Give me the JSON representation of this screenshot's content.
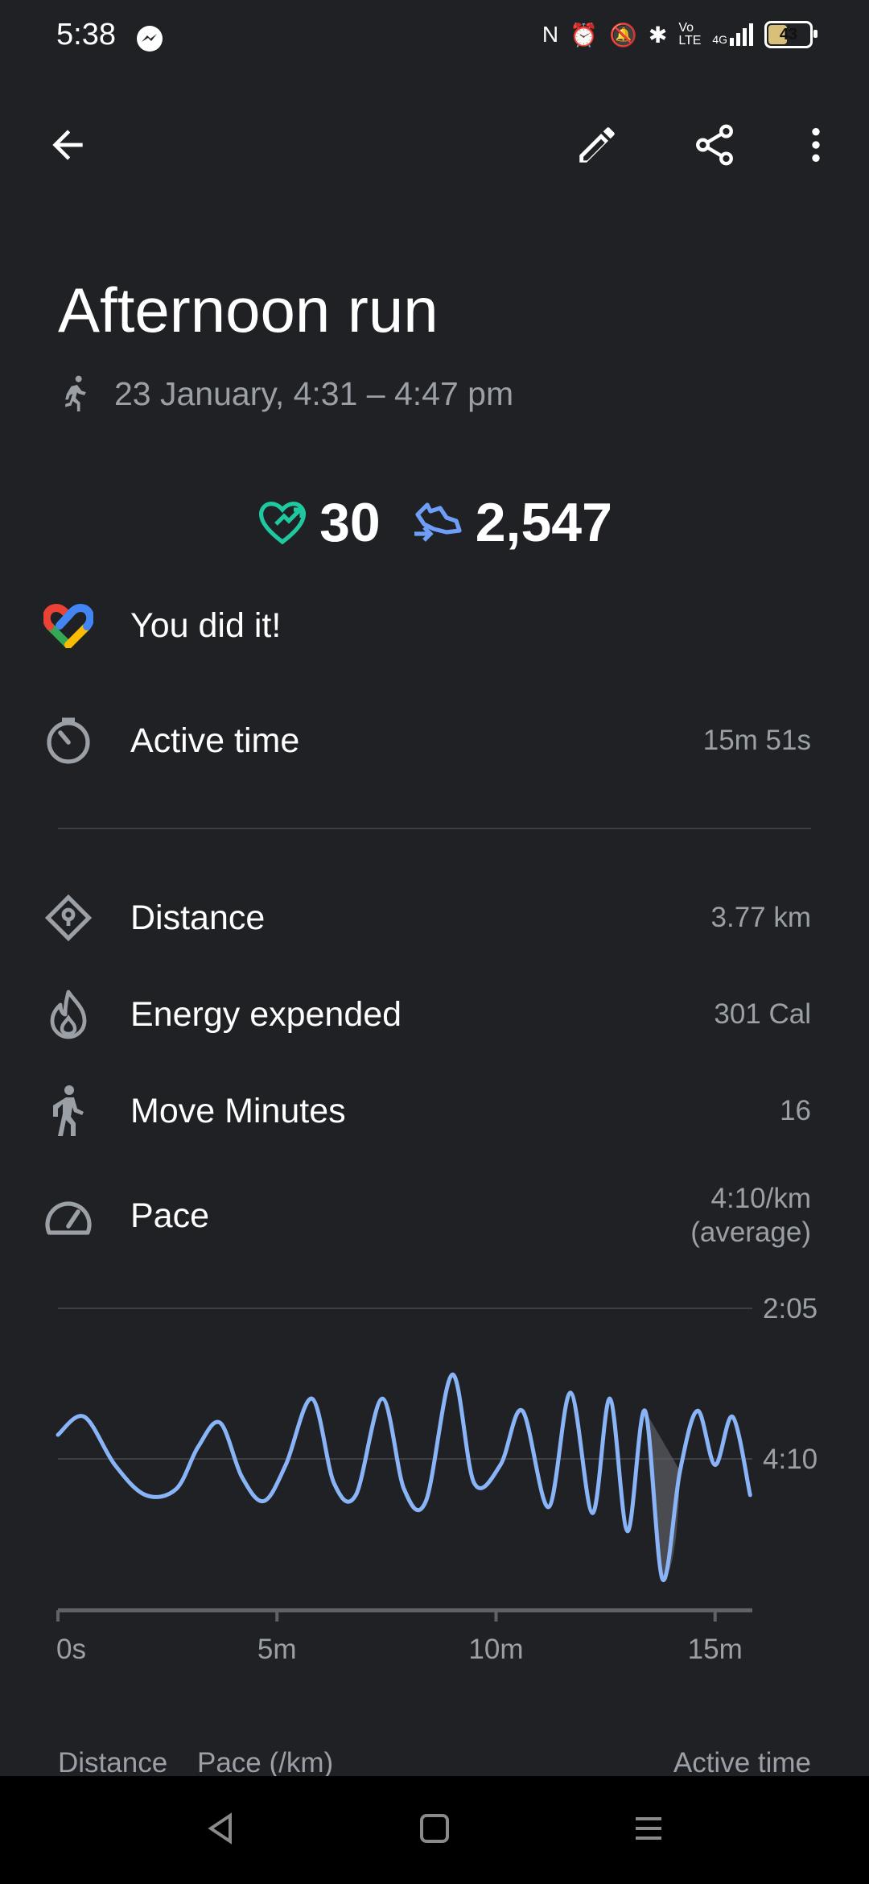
{
  "status_bar": {
    "time": "5:38",
    "network": "4G",
    "volte": "Vo LTE",
    "battery": "43"
  },
  "header": {
    "back_icon": "arrow-back-icon",
    "edit_icon": "pencil-icon",
    "share_icon": "share-icon",
    "more_icon": "more-vert-icon"
  },
  "activity": {
    "title": "Afternoon run",
    "datetime": "23 January, 4:31 – 4:47 pm",
    "heart_points": "30",
    "steps": "2,547"
  },
  "goal": {
    "label": "You did it!"
  },
  "metrics": [
    {
      "icon": "timer-icon",
      "label": "Active time",
      "value": "15m 51s"
    },
    {
      "icon": "location-icon",
      "label": "Distance",
      "value": "3.77 km"
    },
    {
      "icon": "flame-icon",
      "label": "Energy expended",
      "value": "301 Cal"
    },
    {
      "icon": "walker-icon",
      "label": "Move Minutes",
      "value": "16"
    },
    {
      "icon": "speedometer-icon",
      "label": "Pace",
      "value": "4:10/km",
      "value_sub": "(average)"
    }
  ],
  "colors": {
    "background": "#202124",
    "heart_green": "#1ec9a0",
    "steps_blue": "#6e9ef7",
    "line_blue": "#8ab4f8"
  },
  "chart_data": {
    "type": "line",
    "title": "",
    "xlabel": "",
    "ylabel": "Pace",
    "x_ticks": [
      "0s",
      "5m",
      "10m",
      "15m"
    ],
    "y_ticks": [
      "2:05",
      "4:10"
    ],
    "ylim": [
      "2:05",
      "6:15"
    ],
    "xlim": [
      0,
      15.85
    ],
    "series": [
      {
        "x": [
          0,
          0.6,
          1.3,
          2.0,
          2.7,
          3.2,
          3.7,
          4.2,
          4.7,
          5.2,
          5.8,
          6.3,
          6.8,
          7.4,
          7.9,
          8.4,
          9.0,
          9.5,
          10.1,
          10.6,
          11.2,
          11.7,
          12.2,
          12.6,
          13.0,
          13.4,
          13.8,
          14.2,
          14.6,
          15.0,
          15.4,
          15.8
        ],
        "y": [
          "3:50",
          "3:35",
          "4:15",
          "4:40",
          "4:35",
          "4:00",
          "3:40",
          "4:25",
          "4:45",
          "4:15",
          "3:20",
          "4:30",
          "4:40",
          "3:20",
          "4:35",
          "4:45",
          "3:00",
          "4:30",
          "4:15",
          "3:30",
          "4:50",
          "3:15",
          "4:55",
          "3:20",
          "5:10",
          "3:30",
          "5:50",
          "4:20",
          "3:30",
          "4:15",
          "3:35",
          "4:40"
        ]
      }
    ]
  },
  "footer": {
    "col_distance": "Distance",
    "col_pace": "Pace (/km)",
    "col_active": "Active time"
  }
}
